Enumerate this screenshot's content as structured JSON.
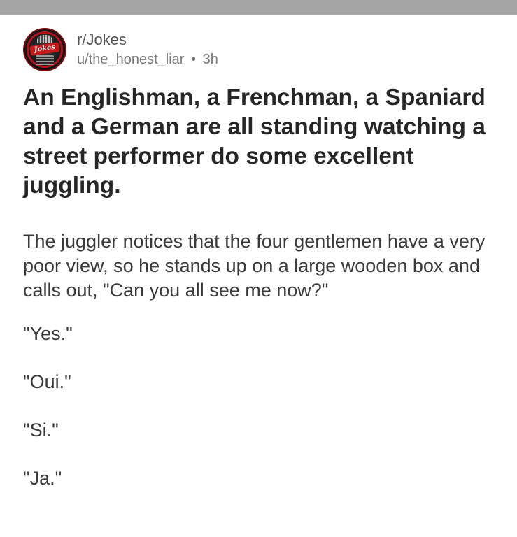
{
  "post": {
    "subreddit": "r/Jokes",
    "author": "u/the_honest_liar",
    "separator": "•",
    "age": "3h",
    "avatar_text": "Jokes",
    "title": "An Englishman, a Frenchman, a Spaniard and a German are all standing watching a street performer do some excellent juggling.",
    "body": [
      "The juggler notices that the four gentlemen have a very poor view, so he stands up on a large wooden box and calls out, \"Can you all see me now?\"",
      "\"Yes.\"",
      "\"Oui.\"",
      "\"Si.\"",
      "\"Ja.\""
    ]
  },
  "colors": {
    "status_bar": "#a6a6a6",
    "title_text": "#262626",
    "body_text": "#3a3a3a",
    "meta_text": "#7a7a7a",
    "avatar_accent": "#b3121a"
  }
}
